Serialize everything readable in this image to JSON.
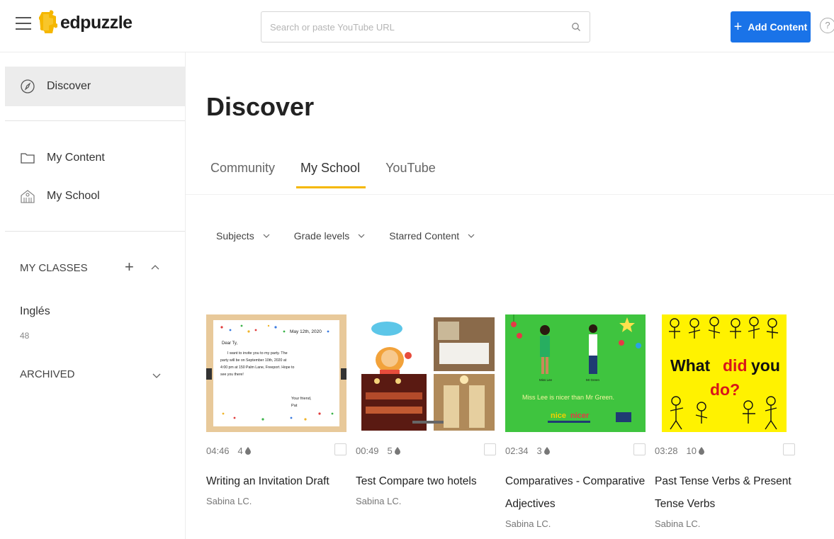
{
  "header": {
    "logo_text": "edpuzzle",
    "search_placeholder": "Search or paste YouTube URL",
    "add_button_label": "Add Content",
    "help_label": "?"
  },
  "sidebar": {
    "discover_label": "Discover",
    "my_content_label": "My Content",
    "my_school_label": "My School",
    "my_classes_label": "MY CLASSES",
    "classes": [
      {
        "name": "Inglés",
        "count": "48"
      }
    ],
    "archived_label": "ARCHIVED"
  },
  "main": {
    "title": "Discover",
    "tabs": [
      {
        "label": "Community",
        "active": false
      },
      {
        "label": "My School",
        "active": true
      },
      {
        "label": "YouTube",
        "active": false
      }
    ],
    "filters": [
      {
        "label": "Subjects"
      },
      {
        "label": "Grade levels"
      },
      {
        "label": "Starred Content"
      }
    ],
    "cards": [
      {
        "duration": "04:46",
        "questions": "4",
        "title": "Writing an Invitation Draft",
        "author": "Sabina LC.",
        "thumb": "invitation"
      },
      {
        "duration": "00:49",
        "questions": "5",
        "title": "Test Compare two hotels",
        "author": "Sabina LC.",
        "thumb": "hotels"
      },
      {
        "duration": "02:34",
        "questions": "3",
        "title": "Comparatives - Comparative Adjectives",
        "author": "Sabina LC.",
        "thumb": "comparatives"
      },
      {
        "duration": "03:28",
        "questions": "10",
        "title": "Past Tense Verbs & Present Tense Verbs",
        "author": "Sabina LC.",
        "thumb": "pasttense"
      }
    ]
  },
  "thumbs": {
    "invitation": {
      "date": "May 12th, 2020",
      "greeting": "Dear Ty,",
      "body_1": "I want to invite you to my party. The",
      "body_2": "party will be on September 10th, 2020 at",
      "body_3": "4:00 pm at 150 Palm Lane, Freeport. Hope to",
      "body_4": "see you there!",
      "closing": "Your friend,",
      "signature": "Pat"
    },
    "comparatives": {
      "name_left": "Miss Lee",
      "name_right": "Mr Green",
      "sentence": "Miss Lee is nicer than Mr Green.",
      "word_nice": "nice",
      "word_nicer": "nicer"
    },
    "pasttense": {
      "line1_a": "What",
      "line1_b": "did",
      "line1_c": "you",
      "line2": "do?"
    }
  },
  "colors": {
    "accent_blue": "#1a73e8",
    "tab_underline": "#f5b700",
    "logo_yellow": "#f5b700",
    "sidebar_selected": "#ececec",
    "comparatives_bg": "#3fc43f",
    "pasttense_bg": "#fff200",
    "pasttense_red": "#d8161a"
  },
  "icons": {
    "menu": "hamburger-icon",
    "search": "search-icon",
    "discover": "compass-icon",
    "my_content": "folder-icon",
    "my_school": "school-building-icon",
    "question": "question-drop-icon"
  }
}
